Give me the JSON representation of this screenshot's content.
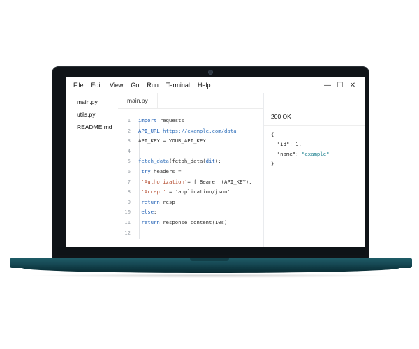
{
  "menu": {
    "items": [
      "File",
      "Edit",
      "View",
      "Go",
      "Run",
      "Terminal",
      "Help"
    ]
  },
  "window_controls": {
    "minimize": "—",
    "maximize": "☐",
    "close": "✕"
  },
  "sidebar": {
    "files": [
      "main.py",
      "utils.py",
      "README.md"
    ]
  },
  "tabs": {
    "active": "main.py"
  },
  "editor": {
    "lines": [
      {
        "n": "1",
        "parts": [
          [
            "kw",
            "import"
          ],
          [
            "txt",
            " requests"
          ]
        ]
      },
      {
        "n": "2",
        "parts": [
          [
            "kw",
            "API_URL"
          ],
          [
            "txt",
            "  "
          ],
          [
            "fn",
            "https://example.com/data"
          ]
        ]
      },
      {
        "n": "3",
        "parts": [
          [
            "txt",
            "API_KEY = YOUR_API_KEY"
          ]
        ]
      },
      {
        "n": "4",
        "parts": []
      },
      {
        "n": "5",
        "parts": [
          [
            "fn",
            "fetch_data"
          ],
          [
            "txt",
            "(fetoh_data("
          ],
          [
            "kw",
            "dit"
          ],
          [
            "txt",
            "):"
          ]
        ]
      },
      {
        "n": "6",
        "parts": [
          [
            "txt",
            "  "
          ],
          [
            "kw",
            "try"
          ],
          [
            "txt",
            " headers ="
          ]
        ]
      },
      {
        "n": "7",
        "parts": [
          [
            "txt",
            "    "
          ],
          [
            "str",
            "'Authorization'"
          ],
          [
            "txt",
            "= f'Bearer (API_KEY),"
          ]
        ]
      },
      {
        "n": "8",
        "parts": [
          [
            "txt",
            "    "
          ],
          [
            "str",
            "'Accept'"
          ],
          [
            "txt",
            " = 'application/json'"
          ]
        ]
      },
      {
        "n": "9",
        "parts": [
          [
            "txt",
            "  "
          ],
          [
            "kw",
            "return"
          ],
          [
            "txt",
            " resp"
          ]
        ]
      },
      {
        "n": "10",
        "parts": [
          [
            "txt",
            "  "
          ],
          [
            "kw",
            "else"
          ],
          [
            "txt",
            ":"
          ]
        ]
      },
      {
        "n": "11",
        "parts": [
          [
            "txt",
            "    "
          ],
          [
            "kw",
            "return"
          ],
          [
            "txt",
            " response.content(10s)"
          ]
        ]
      },
      {
        "n": "12",
        "parts": []
      }
    ]
  },
  "output": {
    "status": "200 OK",
    "json_open": "{",
    "json_id_key": "  \"id\": ",
    "json_id_val": "1,",
    "json_name_key": "  \"name\": ",
    "json_name_val": "\"example\"",
    "json_close": "}"
  }
}
